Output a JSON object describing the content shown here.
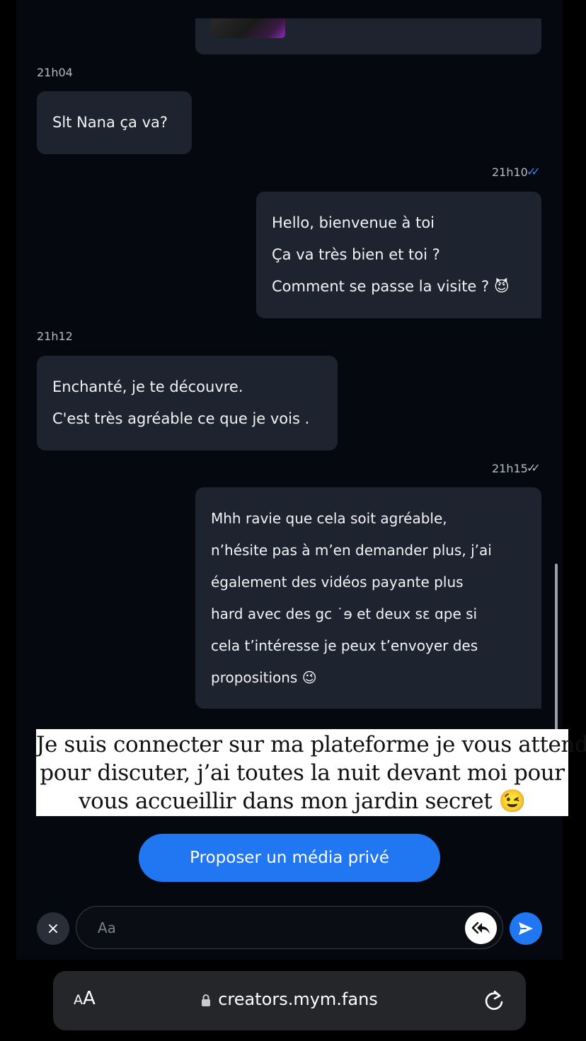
{
  "messages": [
    {
      "time": "21h04",
      "text": "Slt Nana ça va?"
    },
    {
      "time": "21h10",
      "ticks": "✓✓",
      "ticks_color": "#3b82f6",
      "lines": [
        "Hello, bienvenue à toi",
        "Ça va très bien et toi ?",
        "Comment se passe la visite ? 😈"
      ]
    },
    {
      "time": "21h12",
      "lines": [
        "Enchanté, je te découvre.",
        "C'est très agréable ce que je vois ."
      ]
    },
    {
      "time": "21h15",
      "ticks": "✓✓",
      "ticks_color": "#b6bac4",
      "lines": [
        "Mhh ravie que cela soit agréable,",
        "n’hésite pas à m’en demander plus, j’ai",
        "également des vidéos payante plus",
        "hard avec des gc ˙ɘ et deux sɛ ɑpe si",
        "cela t’intéresse je peux t’envoyer des",
        "propositions 😉"
      ]
    }
  ],
  "caption": {
    "lines": [
      "Je suis connecter sur ma plateforme je vous attend",
      "pour discuter, j’ai toutes la nuit devant moi pour",
      "vous accueillir dans mon jardin secret 😉"
    ]
  },
  "cta": {
    "label": "Proposer un média privé"
  },
  "composer": {
    "placeholder": "Aa",
    "close_icon": "×"
  },
  "browser": {
    "aa_small": "A",
    "aa_big": "A",
    "url": "creators.mym.fans"
  },
  "colors": {
    "accent": "#2176f2",
    "bubble": "#1e2330",
    "background": "#06080f"
  }
}
